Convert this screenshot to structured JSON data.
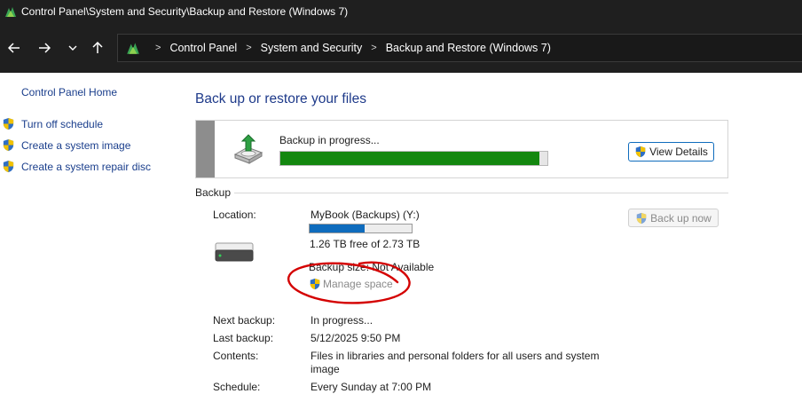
{
  "window": {
    "title": "Control Panel\\System and Security\\Backup and Restore (Windows 7)"
  },
  "navigation": {
    "back_icon": "arrow-left-icon",
    "forward_icon": "arrow-right-icon",
    "recent_icon": "chevron-down-icon",
    "up_icon": "arrow-up-icon",
    "breadcrumb": [
      "Control Panel",
      "System and Security",
      "Backup and Restore (Windows 7)"
    ],
    "separator": ">"
  },
  "sidebar": {
    "home": "Control Panel Home",
    "items": [
      {
        "label": "Turn off schedule",
        "icon": "uac-shield-icon"
      },
      {
        "label": "Create a system image",
        "icon": "uac-shield-icon"
      },
      {
        "label": "Create a system repair disc",
        "icon": "uac-shield-icon"
      }
    ]
  },
  "main": {
    "heading": "Back up or restore your files",
    "progress": {
      "status": "Backup in progress...",
      "fraction": 0.97,
      "bar_color": "#13870f",
      "view_details": "View Details"
    },
    "backup_section": {
      "group_label": "Backup",
      "location_label": "Location:",
      "location_value": "MyBook (Backups) (Y:)",
      "space_used_fraction": 0.54,
      "space_bar_color": "#0f6cbd",
      "free_space": "1.26 TB free of 2.73 TB",
      "backup_size": "Backup size: Not Available",
      "manage_space": "Manage space",
      "back_up_now": "Back up now",
      "details": [
        {
          "label": "Next backup:",
          "value": "In progress..."
        },
        {
          "label": "Last backup:",
          "value": "5/12/2025 9:50 PM"
        },
        {
          "label": "Contents:",
          "value": "Files in libraries and personal folders for all users and system",
          "value_line2": "image"
        },
        {
          "label": "Schedule:",
          "value": "Every Sunday at 7:00 PM"
        }
      ]
    }
  },
  "colors": {
    "link": "#1a3e8c",
    "heading": "#1e3a8a",
    "annotation_circle": "#d40000"
  }
}
